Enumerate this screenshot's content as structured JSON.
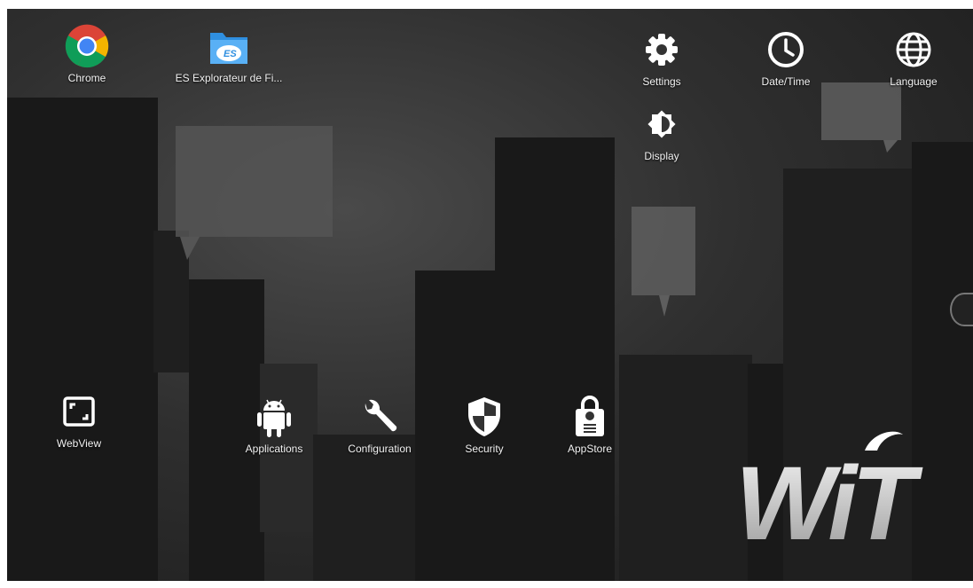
{
  "desktop": {
    "top_left_apps": [
      {
        "label": "Chrome",
        "icon": "chrome-icon"
      },
      {
        "label": "ES Explorateur de Fi...",
        "icon": "es-file-explorer-icon"
      }
    ],
    "top_right_apps": [
      {
        "label": "Settings",
        "icon": "gear-icon"
      },
      {
        "label": "Date/Time",
        "icon": "clock-icon"
      },
      {
        "label": "Language",
        "icon": "globe-icon"
      },
      {
        "label": "Display",
        "icon": "brightness-icon"
      }
    ],
    "bottom_apps": [
      {
        "label": "WebView",
        "icon": "fullscreen-frame-icon"
      },
      {
        "label": "Applications",
        "icon": "android-icon"
      },
      {
        "label": "Configuration",
        "icon": "wrench-icon"
      },
      {
        "label": "Security",
        "icon": "shield-icon"
      },
      {
        "label": "AppStore",
        "icon": "store-bag-icon"
      }
    ],
    "logo_text": "WiT"
  },
  "colors": {
    "chrome_red": "#DB4437",
    "chrome_yellow": "#F4B400",
    "chrome_green": "#0F9D58",
    "chrome_blue": "#4285F4",
    "es_blue": "#2F8FE0"
  }
}
